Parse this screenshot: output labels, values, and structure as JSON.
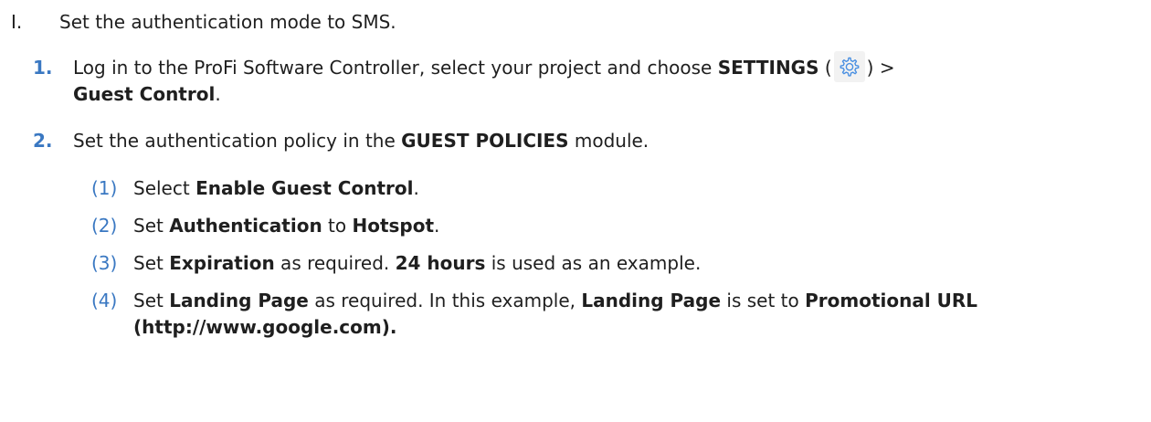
{
  "colors": {
    "text": "#1f1f1f",
    "number_accent": "#3a78c2",
    "gear_icon": "#4a90e2"
  },
  "section": {
    "marker": "I.",
    "text": "Set the authentication mode to SMS."
  },
  "step1": {
    "number": "1.",
    "t1": "Log in to the ProFi Software Controller, select your project and choose ",
    "b1": "SETTINGS",
    "t2": " (",
    "icon": "gear-icon",
    "t3": ") >",
    "b2": "Guest Control",
    "t4": "."
  },
  "step2": {
    "number": "2.",
    "t1": "Set the authentication policy in the ",
    "b1": "GUEST POLICIES",
    "t2": " module.",
    "substeps": [
      {
        "marker": "(1)",
        "t1": "Select ",
        "b1": "Enable Guest Control",
        "t2": "."
      },
      {
        "marker": "(2)",
        "t1": "Set ",
        "b1": "Authentication",
        "t2": " to ",
        "b2": "Hotspot",
        "t3": "."
      },
      {
        "marker": "(3)",
        "t1": "Set ",
        "b1": "Expiration",
        "t2": " as required. ",
        "b2": "24 hours",
        "t3": " is used as an example."
      },
      {
        "marker": "(4)",
        "t1": "Set ",
        "b1": "Landing Page",
        "t2": " as required. In this example, ",
        "b2": "Landing Page",
        "t3": " is set to ",
        "b3": "Promotional URL",
        "b4": "(http://www.google.com)."
      }
    ]
  }
}
